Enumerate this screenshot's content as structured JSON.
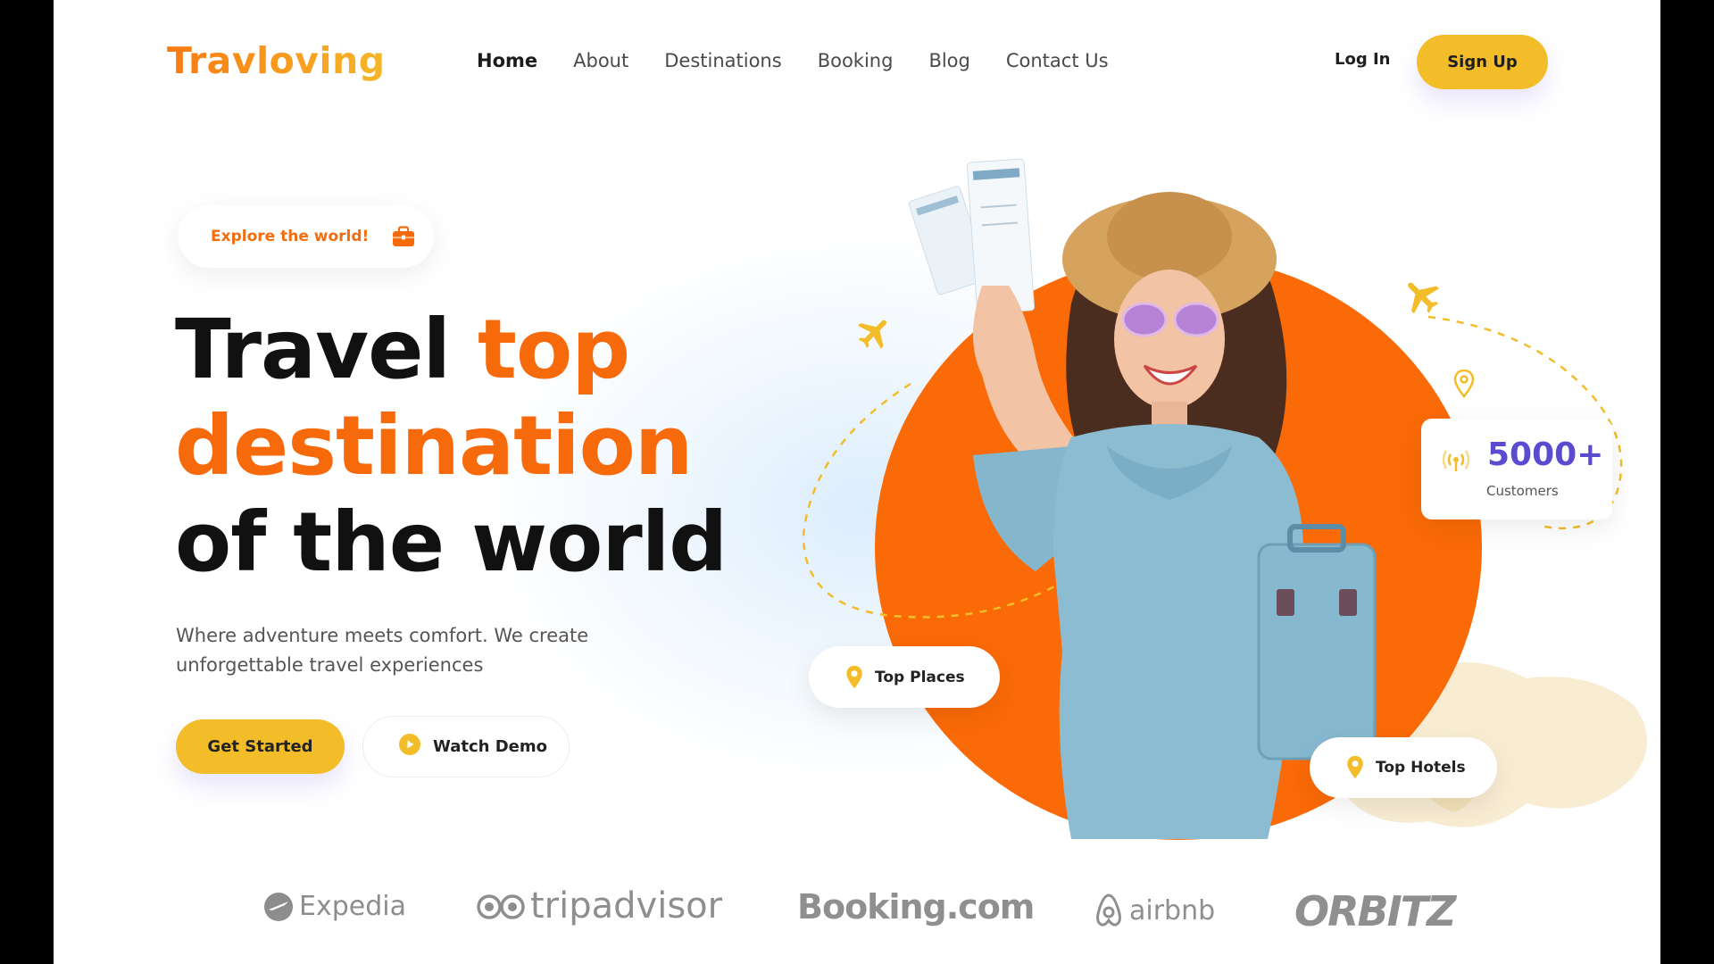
{
  "brand": {
    "name": "Travloving"
  },
  "nav": {
    "items": [
      {
        "label": "Home",
        "active": true
      },
      {
        "label": "About"
      },
      {
        "label": "Destinations"
      },
      {
        "label": "Booking"
      },
      {
        "label": "Blog"
      },
      {
        "label": "Contact Us"
      }
    ],
    "login_label": "Log In",
    "signup_label": "Sign Up"
  },
  "hero": {
    "tagline": "Explore the world!",
    "headline": {
      "line1_dark": "Travel",
      "line1_orange": "top",
      "line2_orange": "destination",
      "line3_dark": "of the world"
    },
    "subtext_line1": "Where adventure meets comfort. We create",
    "subtext_line2": "unforgettable travel experiences",
    "cta_primary": "Get Started",
    "cta_secondary": "Watch Demo"
  },
  "stats": {
    "value": "5000+",
    "label": "Customers"
  },
  "badges": {
    "places": "Top Places",
    "hotels": "Top Hotels"
  },
  "partners": {
    "expedia": "Expedia",
    "tripadvisor": "tripadvisor",
    "booking": "Booking.com",
    "airbnb": "airbnb",
    "orbitz": "ORBITZ"
  },
  "colors": {
    "accent_orange": "#f76a0c",
    "accent_yellow": "#f2bd28",
    "stat_purple": "#5a4bd0"
  },
  "icons": [
    "briefcase-icon",
    "play-icon",
    "airplane-icon",
    "location-pin-icon",
    "broadcast-icon"
  ]
}
